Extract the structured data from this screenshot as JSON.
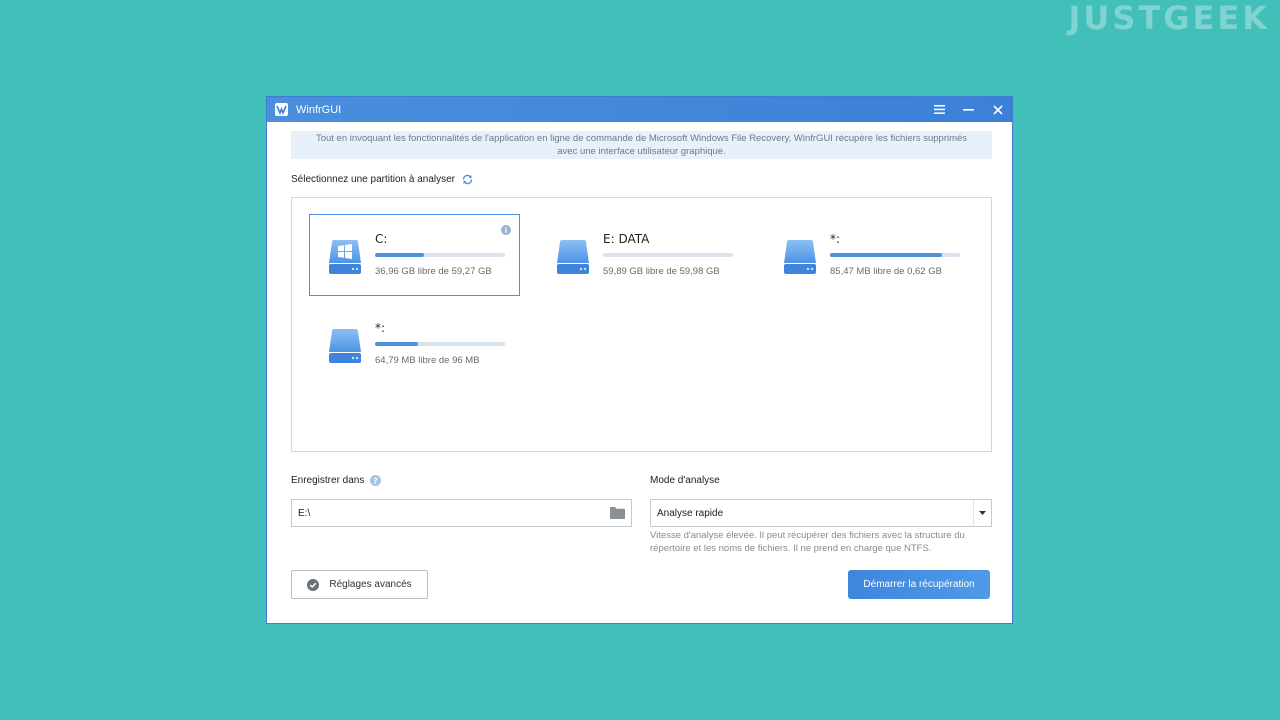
{
  "watermark": "JUSTGEEK",
  "window": {
    "title": "WinfrGUI"
  },
  "banner": {
    "line1": "Tout en invoquant les fonctionnalités de l'application en ligne de commande de Microsoft Windows File Recovery, WinfrGUI récupère les fichiers supprimés",
    "line2": "avec une interface utilisateur graphique."
  },
  "partition_section": {
    "label": "Sélectionnez une partition à analyser"
  },
  "partitions": [
    {
      "name": "C:",
      "size_text": "36,96 GB libre de 59,27 GB",
      "used_fraction": 0.38,
      "selected": true,
      "icon": "windows-drive-icon"
    },
    {
      "name": "E: DATA",
      "size_text": "59,89 GB libre de 59,98 GB",
      "used_fraction": 0.0,
      "selected": false,
      "icon": "drive-icon"
    },
    {
      "name": "*:",
      "size_text": "85,47 MB libre de 0,62 GB",
      "used_fraction": 0.86,
      "selected": false,
      "icon": "drive-icon"
    },
    {
      "name": "*:",
      "size_text": "64,79 MB libre de 96 MB",
      "used_fraction": 0.33,
      "selected": false,
      "icon": "drive-icon"
    }
  ],
  "save_location": {
    "label": "Enregistrer dans",
    "value": "E:\\"
  },
  "scan_mode": {
    "label": "Mode d'analyse",
    "selected": "Analyse rapide",
    "description": "Vitesse d'analyse élevée. Il peut récupérer des fichiers avec la structure du répertoire et les noms de fichiers. Il ne prend en charge que NTFS."
  },
  "buttons": {
    "advanced": "Réglages avancés",
    "start": "Démarrer la récupération"
  },
  "colors": {
    "background": "#43bfba",
    "titlebar": "#4a8edd",
    "accent": "#4f8fe0",
    "banner": "#e8f0fa"
  }
}
